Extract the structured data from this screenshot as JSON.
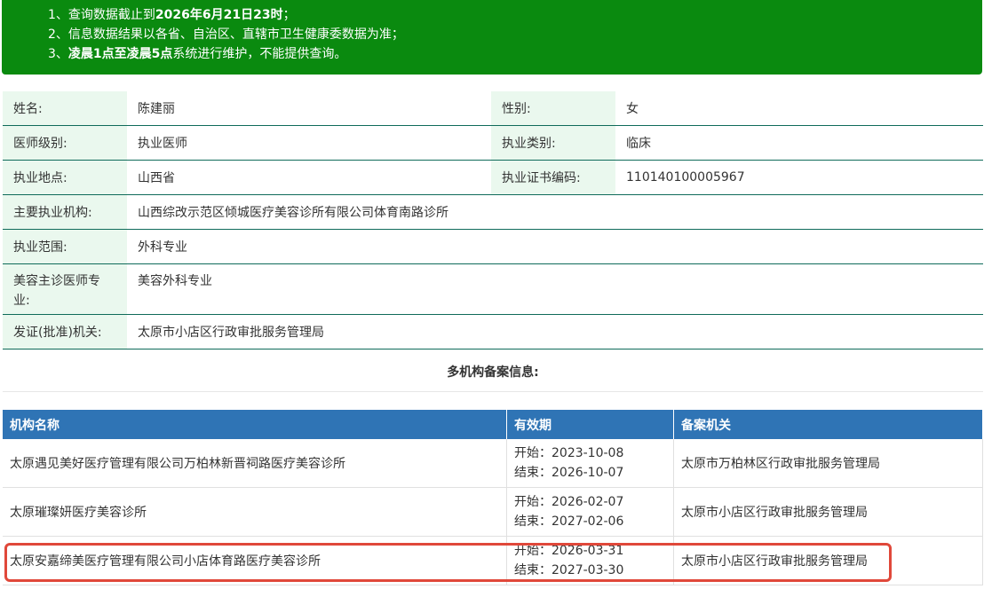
{
  "notice": {
    "lines": [
      {
        "prefix": "1、查询数据截止到",
        "bold": "2026年6月21日23时",
        "suffix": "；"
      },
      {
        "prefix": "2、信息数据结果以各省、自治区、直辖市卫生健康委数据为准；",
        "bold": "",
        "suffix": ""
      },
      {
        "prefix": "3、",
        "bold": "凌晨1点至凌晨5点",
        "suffix": "系统进行维护，不能提供查询。"
      }
    ]
  },
  "info": {
    "name_label": "姓名:",
    "name": "陈建丽",
    "gender_label": "性别:",
    "gender": "女",
    "level_label": "医师级别:",
    "level": "执业医师",
    "category_label": "执业类别:",
    "category": "临床",
    "location_label": "执业地点:",
    "location": "山西省",
    "cert_label": "执业证书编码:",
    "cert": "110140100005967",
    "org_label": "主要执业机构:",
    "org": "山西综改示范区倾城医疗美容诊所有限公司体育南路诊所",
    "scope_label": "执业范围:",
    "scope": "外科专业",
    "beauty_label": "美容主诊医师专业:",
    "beauty": "美容外科专业",
    "issuer_label": "发证(批准)机关:",
    "issuer": "太原市小店区行政审批服务管理局"
  },
  "multi": {
    "title": "多机构备案信息:",
    "headers": [
      "机构名称",
      "有效期",
      "备案机关"
    ],
    "rows": [
      {
        "name": "太原遇见美好医疗管理有限公司万柏林新晋祠路医疗美容诊所",
        "start": "开始：2023-10-08",
        "end": "结束：2026-10-07",
        "authority": "太原市万柏林区行政审批服务管理局"
      },
      {
        "name": "太原璀璨妍医疗美容诊所",
        "start": "开始：2026-02-07",
        "end": "结束：2027-02-06",
        "authority": "太原市小店区行政审批服务管理局"
      },
      {
        "name": "太原安嘉缔美医疗管理有限公司小店体育路医疗美容诊所",
        "start": "开始：2026-03-31",
        "end": "结束：2027-03-30",
        "authority": "太原市小店区行政审批服务管理局"
      }
    ]
  },
  "colors": {
    "notice_bg": "#0a8a0f",
    "label_bg": "#eaf8ee",
    "header_bg": "#2f74b5",
    "highlight": "#e0483a"
  }
}
